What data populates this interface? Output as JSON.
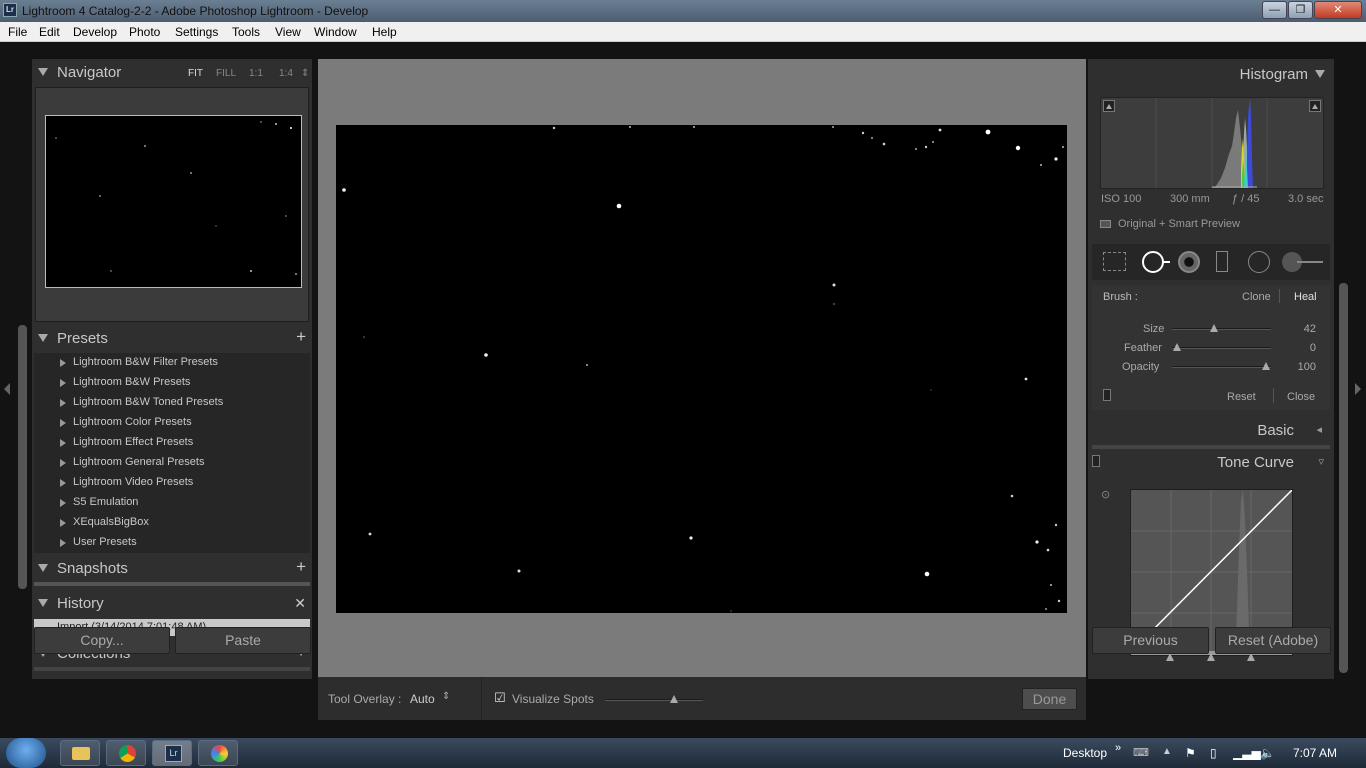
{
  "window": {
    "title": "Lightroom 4 Catalog-2-2 - Adobe Photoshop Lightroom - Develop",
    "logo_text": "Lr",
    "minimize_glyph": "—",
    "maximize_glyph": "❐",
    "close_glyph": "✕"
  },
  "menu": [
    "File",
    "Edit",
    "Develop",
    "Photo",
    "Settings",
    "Tools",
    "View",
    "Window",
    "Help"
  ],
  "left": {
    "navigator": {
      "title": "Navigator",
      "zoom": [
        "FIT",
        "FILL",
        "1:1",
        "1:4"
      ],
      "zoom_active": "FIT"
    },
    "presets": {
      "title": "Presets",
      "add_glyph": "+",
      "items": [
        "Lightroom B&W Filter Presets",
        "Lightroom B&W Presets",
        "Lightroom B&W Toned Presets",
        "Lightroom Color Presets",
        "Lightroom Effect Presets",
        "Lightroom General Presets",
        "Lightroom Video Presets",
        "S5 Emulation",
        "XEqualsBigBox",
        "User Presets"
      ]
    },
    "snapshots": {
      "title": "Snapshots",
      "add_glyph": "+"
    },
    "history": {
      "title": "History",
      "clear_glyph": "✕",
      "items": [
        "Import (3/14/2014 7:01:48 AM)"
      ]
    },
    "collections": {
      "title": "Collections",
      "add_glyph": "+"
    },
    "copy_label": "Copy...",
    "paste_label": "Paste"
  },
  "toolbar": {
    "tool_overlay_label": "Tool Overlay :",
    "tool_overlay_value": "Auto",
    "visualize_spots_label": "Visualize Spots",
    "visualize_spots_checked": true,
    "visualize_threshold": 0.7,
    "done_label": "Done"
  },
  "right": {
    "histogram": {
      "title": "Histogram",
      "iso": "ISO 100",
      "focal": "300 mm",
      "aperture": "ƒ / 45",
      "shutter": "3.0 sec",
      "preview_label": "Original + Smart Preview"
    },
    "spot_removal": {
      "brush_label": "Brush :",
      "mode_clone": "Clone",
      "mode_heal": "Heal",
      "mode_active": "Heal",
      "size_label": "Size",
      "size_value": "42",
      "feather_label": "Feather",
      "feather_value": "0",
      "opacity_label": "Opacity",
      "opacity_value": "100",
      "reset_label": "Reset",
      "close_label": "Close"
    },
    "basic_title": "Basic",
    "tone_curve_title": "Tone Curve",
    "previous_label": "Previous",
    "reset_label": "Reset (Adobe)"
  },
  "taskbar": {
    "desktop_label": "Desktop",
    "time": "7:07 AM",
    "apps": [
      "explorer-icon",
      "chrome-icon",
      "lightroom-icon",
      "paint-icon"
    ]
  },
  "colors": {
    "panel_bg": "#2f2f2f",
    "canvas_bg": "#7b7b7b",
    "heal_active": "#e0e0e0"
  }
}
